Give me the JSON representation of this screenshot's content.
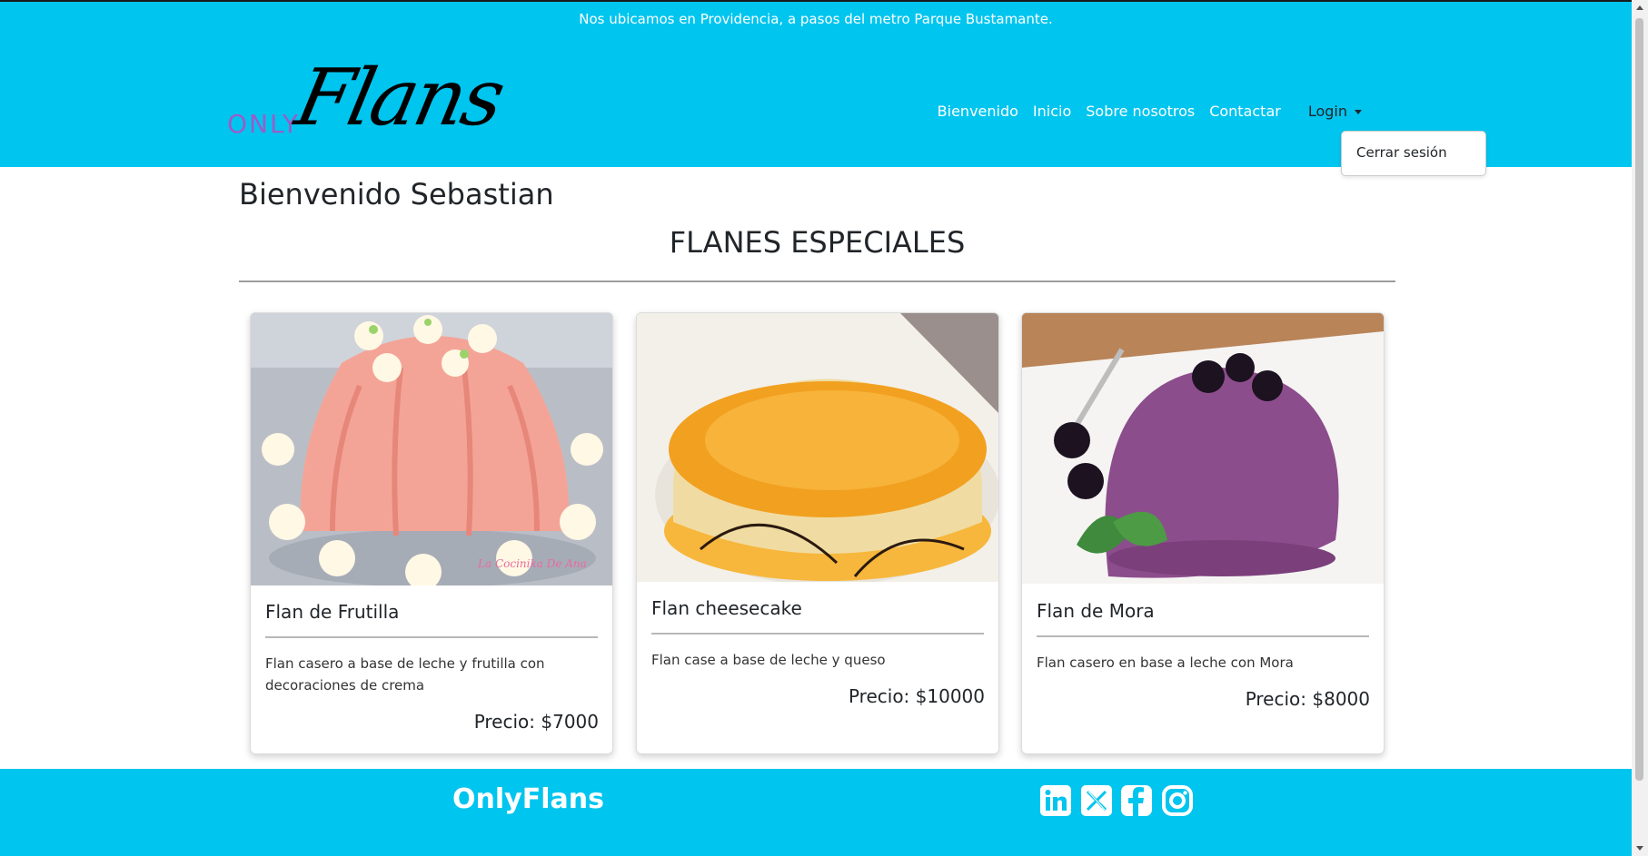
{
  "topbar": {
    "text": "Nos ubicamos en Providencia, a pasos del metro Parque Bustamante."
  },
  "logo": {
    "only": "ONLY",
    "flans": "Flans"
  },
  "nav": {
    "links": [
      "Bienvenido",
      "Inicio",
      "Sobre nosotros",
      "Contactar"
    ],
    "login": "Login",
    "dropdown_item": "Cerrar sesión"
  },
  "main": {
    "welcome": "Bienvenido Sebastian",
    "section_title": "FLANES ESPECIALES"
  },
  "cards": [
    {
      "title": "Flan de Frutilla",
      "description": "Flan casero a base de leche y frutilla con decoraciones de crema",
      "price": "Precio: $7000",
      "watermark": "La Cocinika De Ana",
      "image": "strawberry-flan-photo"
    },
    {
      "title": "Flan cheesecake",
      "description": "Flan case a base de leche y queso",
      "price": "Precio: $10000",
      "image": "cheesecake-flan-photo"
    },
    {
      "title": "Flan de Mora",
      "description": "Flan casero en base a leche con Mora",
      "price": "Precio: $8000",
      "image": "blackberry-flan-photo"
    }
  ],
  "footer": {
    "brand": "OnlyFlans",
    "social_icons": [
      "linkedin-icon",
      "x-twitter-icon",
      "facebook-icon",
      "instagram-icon"
    ]
  },
  "colors": {
    "header_bg": "#00c5ef",
    "logo_only": "#9a5cc9",
    "text": "#212529"
  }
}
